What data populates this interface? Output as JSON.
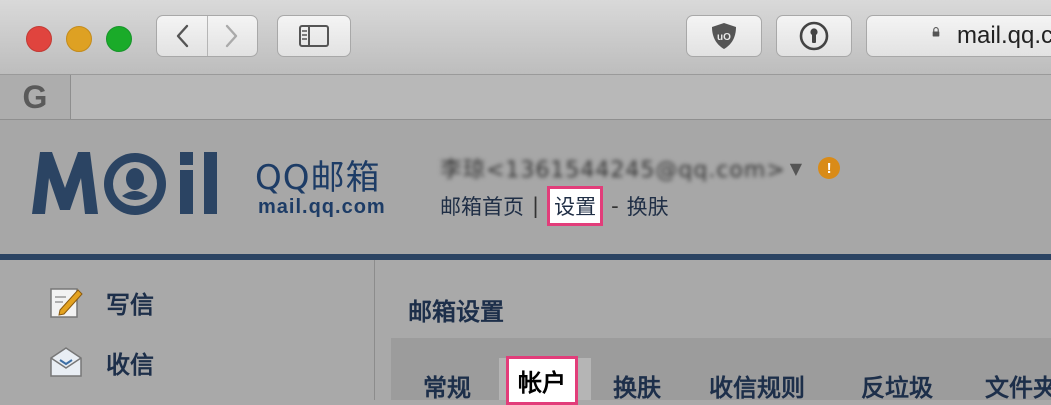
{
  "browser": {
    "address": "mail.qq.c",
    "favorites": [
      {
        "label": "G"
      }
    ]
  },
  "header": {
    "logo_text": "QQ邮箱",
    "logo_sub": "mail.qq.com",
    "account": {
      "display": "李琼<1361544245@qq.com>",
      "dropdown_icon": "▼",
      "warning_icon": "!"
    },
    "nav": {
      "home": "邮箱首页",
      "sep1": "|",
      "settings": "设置",
      "sep2": "-",
      "skin": "换肤"
    }
  },
  "sidebar": {
    "write": "写信",
    "inbox": "收信"
  },
  "main": {
    "title": "邮箱设置",
    "tabs": [
      {
        "label": "常规"
      },
      {
        "label": "帐户"
      },
      {
        "label": "换肤"
      },
      {
        "label": "收信规则"
      },
      {
        "label": "反垃圾"
      },
      {
        "label": "文件夹"
      }
    ]
  },
  "colors": {
    "brand": "#1d3c66",
    "highlight_border": "#e23d7a",
    "warning": "#d98b18"
  }
}
